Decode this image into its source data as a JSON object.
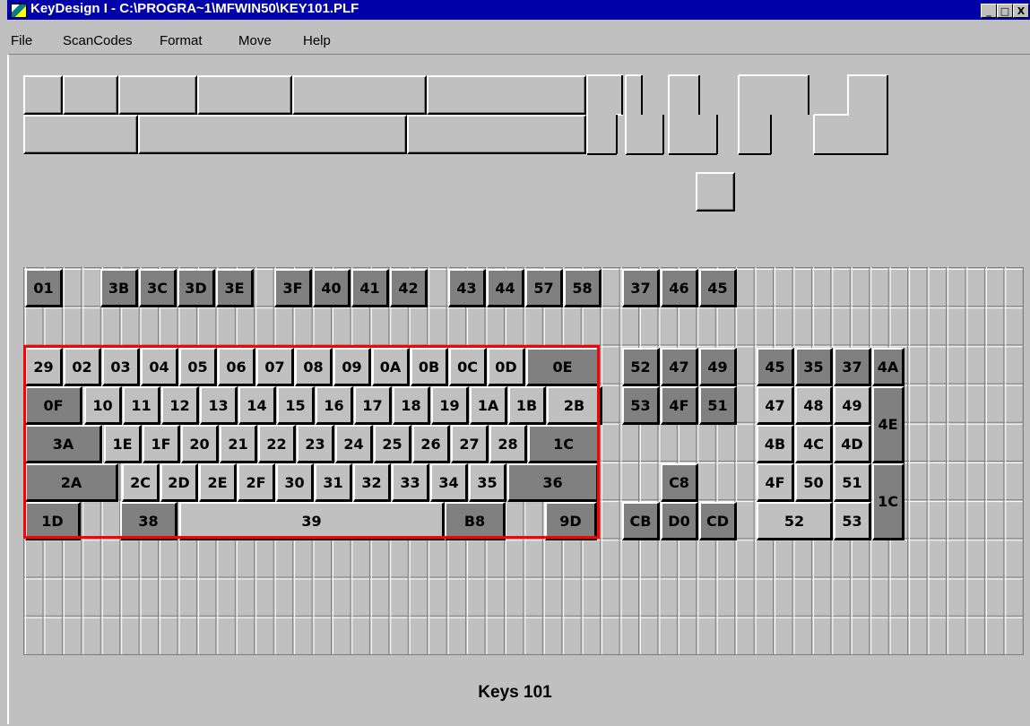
{
  "window": {
    "title": "KeyDesign I - C:\\PROGRA~1\\MFWIN50\\KEY101.PLF",
    "minimize_glyph": "_",
    "maximize_glyph": "□",
    "close_glyph": "X"
  },
  "menu": [
    "File",
    "ScanCodes",
    "Format",
    "Move",
    "Help"
  ],
  "layout_name": "Keys 101",
  "selection_color": "#ff0000",
  "key_colors": {
    "light": "#c0c0c0",
    "dark": "#808080"
  },
  "keys": {
    "function_row": [
      "01",
      "3B",
      "3C",
      "3D",
      "3E",
      "3F",
      "40",
      "41",
      "42",
      "43",
      "44",
      "57",
      "58",
      "37",
      "46",
      "45"
    ],
    "number_row": [
      "29",
      "02",
      "03",
      "04",
      "05",
      "06",
      "07",
      "08",
      "09",
      "0A",
      "0B",
      "0C",
      "0D",
      "0E"
    ],
    "tab_row": [
      "0F",
      "10",
      "11",
      "12",
      "13",
      "14",
      "15",
      "16",
      "17",
      "18",
      "19",
      "1A",
      "1B",
      "2B"
    ],
    "caps_row": [
      "3A",
      "1E",
      "1F",
      "20",
      "21",
      "22",
      "23",
      "24",
      "25",
      "26",
      "27",
      "28",
      "1C"
    ],
    "shift_row": [
      "2A",
      "2C",
      "2D",
      "2E",
      "2F",
      "30",
      "31",
      "32",
      "33",
      "34",
      "35",
      "36"
    ],
    "bottom_row": [
      "1D",
      "38",
      "39",
      "B8",
      "9D"
    ],
    "nav_block": [
      "52",
      "47",
      "49",
      "53",
      "4F",
      "51"
    ],
    "arrow_block": [
      "C8",
      "CB",
      "D0",
      "CD"
    ],
    "numpad": [
      "45",
      "35",
      "37",
      "4A",
      "47",
      "48",
      "49",
      "4E",
      "4B",
      "4C",
      "4D",
      "4F",
      "50",
      "51",
      "1C",
      "52",
      "53"
    ]
  }
}
